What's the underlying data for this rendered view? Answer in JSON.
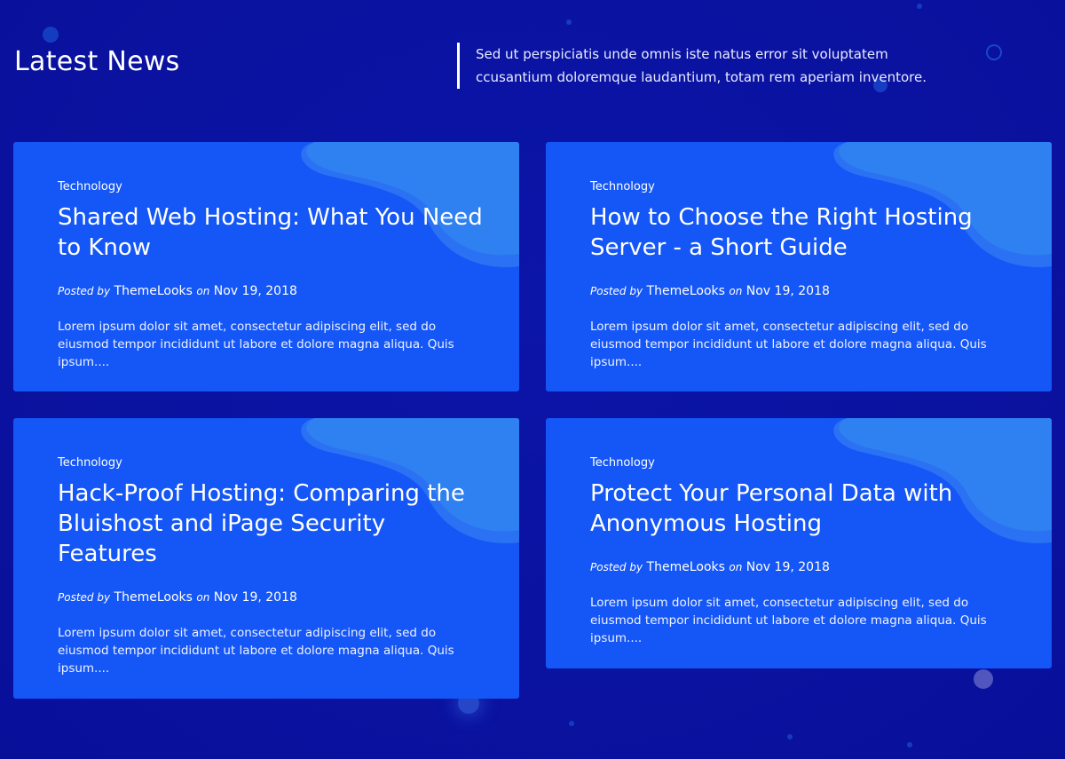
{
  "header": {
    "title": "Latest News",
    "description": "Sed ut perspiciatis unde omnis iste natus error sit voluptatem ccusantium doloremque laudantium, totam rem aperiam inventore."
  },
  "posts": [
    {
      "category": "Technology",
      "title": "Shared Web Hosting: What You Need to Know",
      "posted_by_label": "Posted by",
      "author": "ThemeLooks",
      "on_label": "on",
      "date": "Nov 19, 2018",
      "excerpt": "Lorem ipsum dolor sit amet, consectetur adipiscing elit, sed do eiusmod tempor incididunt ut labore et dolore magna aliqua. Quis ipsum...."
    },
    {
      "category": "Technology",
      "title": "How to Choose the Right Hosting Server - a Short Guide",
      "posted_by_label": "Posted by",
      "author": "ThemeLooks",
      "on_label": "on",
      "date": "Nov 19, 2018",
      "excerpt": "Lorem ipsum dolor sit amet, consectetur adipiscing elit, sed do eiusmod tempor incididunt ut labore et dolore magna aliqua. Quis ipsum...."
    },
    {
      "category": "Technology",
      "title": "Hack-Proof Hosting: Comparing the Bluishost and iPage Security Features",
      "posted_by_label": "Posted by",
      "author": "ThemeLooks",
      "on_label": "on",
      "date": "Nov 19, 2018",
      "excerpt": "Lorem ipsum dolor sit amet, consectetur adipiscing elit, sed do eiusmod tempor incididunt ut labore et dolore magna aliqua. Quis ipsum...."
    },
    {
      "category": "Technology",
      "title": "Protect Your Personal Data with Anonymous Hosting",
      "posted_by_label": "Posted by",
      "author": "ThemeLooks",
      "on_label": "on",
      "date": "Nov 19, 2018",
      "excerpt": "Lorem ipsum dolor sit amet, consectetur adipiscing elit, sed do eiusmod tempor incididunt ut labore et dolore magna aliqua. Quis ipsum...."
    }
  ],
  "colors": {
    "background": "#0a12a0",
    "card": "#1557f6",
    "card_blob": "#2e7ef2"
  }
}
